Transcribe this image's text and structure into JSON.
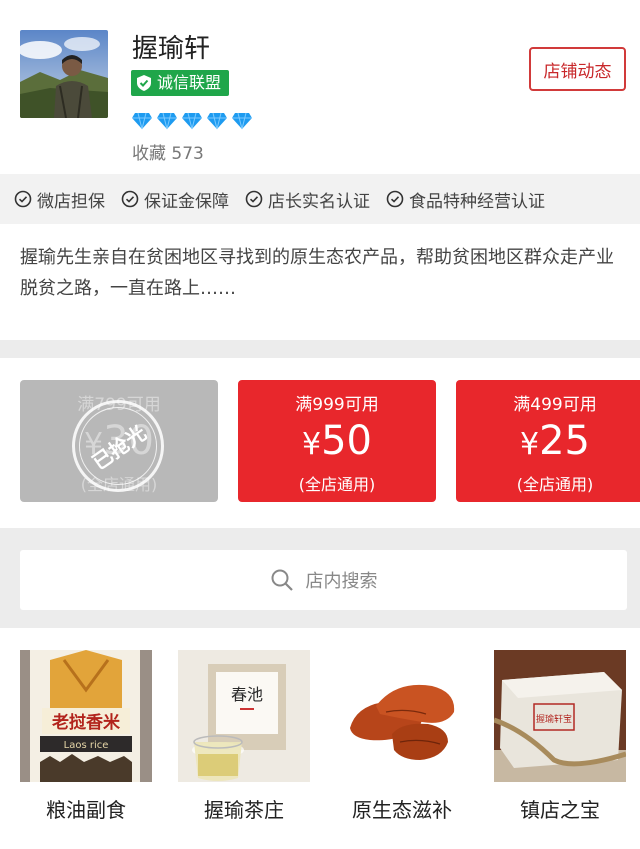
{
  "shop": {
    "name": "握瑜轩",
    "badge": "诚信联盟",
    "diamond_count": 5,
    "favorites_label": "收藏 573",
    "news_button": "店铺动态"
  },
  "guarantees": [
    "微店担保",
    "保证金保障",
    "店长实名认证",
    "食品特种经营认证"
  ],
  "description": "握瑜先生亲自在贫困地区寻找到的原生态农产品，帮助贫困地区群众走产业脱贫之路，一直在路上……",
  "coupons": [
    {
      "condition": "满799可用",
      "currency": "¥",
      "amount": "30",
      "scope": "(全店通用)",
      "status": "已抢光",
      "state": "grabbed"
    },
    {
      "condition": "满999可用",
      "currency": "¥",
      "amount": "50",
      "scope": "(全店通用)",
      "state": "available"
    },
    {
      "condition": "满499可用",
      "currency": "¥",
      "amount": "25",
      "scope": "(全店通用)",
      "state": "available"
    }
  ],
  "search": {
    "placeholder": "店内搜索",
    "icon": "search-icon"
  },
  "categories": [
    {
      "label": "粮油副食",
      "bag_text": "老挝香米",
      "bag_subtext": "Laos rice"
    },
    {
      "label": "握瑜茶庄",
      "card_text": "春池"
    },
    {
      "label": "原生态滋补"
    },
    {
      "label": "镇店之宝",
      "box_text": "握瑜轩宝"
    }
  ],
  "colors": {
    "accent_red": "#e8272c",
    "badge_green": "#1fa64a",
    "gray_coupon": "#b8b8b8",
    "diamond_blue": "#1e9bf0"
  }
}
